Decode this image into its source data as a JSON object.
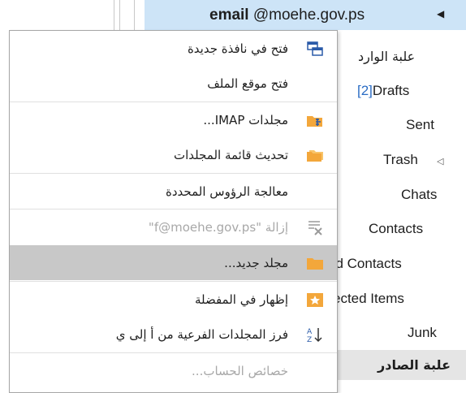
{
  "account": {
    "prefix": "email",
    "domain": "@moehe.gov.ps"
  },
  "folders": {
    "inbox": "علبة الوارد",
    "drafts_count": "[2]",
    "drafts_label": "Drafts",
    "sent": "Sent",
    "trash": "Trash",
    "chats": "Chats",
    "contacts": "Contacts",
    "suggested_contacts": "ed Contacts",
    "rejected_items": "ected Items",
    "junk": "Junk",
    "outbox": "علبة الصادر"
  },
  "menu": {
    "items": [
      {
        "label": "فتح في نافذة جديدة",
        "icon": "open-window-icon"
      },
      {
        "label": "فتح موقع الملف",
        "icon": ""
      },
      {
        "label": "مجلدات IMAP...",
        "icon": "imap-folders-icon"
      },
      {
        "label": "تحديث قائمة المجلدات",
        "icon": "folder-refresh-icon"
      },
      {
        "label": "معالجة الرؤوس المحددة",
        "icon": ""
      },
      {
        "label": "إزالة \"f@moehe.gov.ps\"",
        "icon": "remove-account-icon"
      },
      {
        "label": "مجلد جديد...",
        "icon": "new-folder-icon"
      },
      {
        "label": "إظهار في المفضلة",
        "icon": "favorites-star-icon"
      },
      {
        "label": "فرز المجلدات الفرعية من أ إلى ي",
        "icon": "sort-az-icon"
      },
      {
        "label": "خصائص الحساب...",
        "icon": ""
      }
    ],
    "highlighted_index": 6
  },
  "colors": {
    "selection": "#cde4f7",
    "menu_highlight": "#c8c8c8",
    "drafts_count": "#2a6cc4",
    "icon_orange": "#f3a73b",
    "icon_blue": "#2a5aa8"
  }
}
